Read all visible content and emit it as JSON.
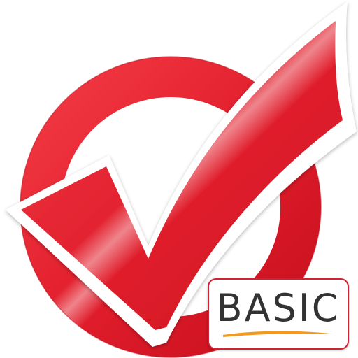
{
  "badge": {
    "label": "BASIC"
  },
  "colors": {
    "primary_red": "#e32030",
    "highlight_red": "#f04a52",
    "badge_border": "#d42030",
    "badge_text": "#333333",
    "swoosh_orange": "#f39a1e"
  },
  "icons": {
    "emblem": "checkmark-in-circle-icon"
  }
}
